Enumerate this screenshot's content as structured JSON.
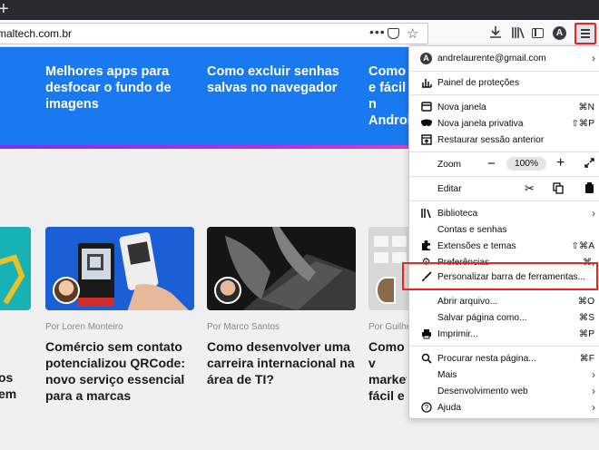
{
  "toolbar": {
    "url": "maltech.com.br",
    "dots": "•••",
    "plus": "+",
    "avatar_letter": "A"
  },
  "hero": {
    "titles": [
      "Melhores apps para desfocar o fundo de imagens",
      "Como excluir senhas salvas no navegador",
      "Como e fácil n Androi"
    ]
  },
  "cards": [
    {
      "author": "",
      "title": "os em"
    },
    {
      "author": "Por Loren Monteiro",
      "title": "Comércio sem contato potencializou QRCode: novo serviço essencial para a marcas"
    },
    {
      "author": "Por Marco Santos",
      "title": "Como desenvolver uma carreira internacional na área de TI?"
    },
    {
      "author": "Por Guilhe",
      "title": "Como v market fácil e"
    }
  ],
  "menu": {
    "account": "andrelaurente@gmail.com",
    "protections": "Painel de proteções",
    "new_window": "Nova janela",
    "new_window_sc": "⌘N",
    "new_private": "Nova janela privativa",
    "new_private_sc": "⇧⌘P",
    "restore": "Restaurar sessão anterior",
    "zoom": "Zoom",
    "zoom_value": "100%",
    "edit": "Editar",
    "library": "Biblioteca",
    "accounts": "Contas e senhas",
    "addons": "Extensões e temas",
    "addons_sc": "⇧⌘A",
    "prefs": "Preferências",
    "prefs_sc": "⌘,",
    "customize": "Personalizar barra de ferramentas...",
    "open_file": "Abrir arquivo...",
    "open_file_sc": "⌘O",
    "save_page": "Salvar página como...",
    "save_page_sc": "⌘S",
    "print": "Imprimir...",
    "print_sc": "⌘P",
    "find": "Procurar nesta página...",
    "find_sc": "⌘F",
    "more": "Mais",
    "webdev": "Desenvolvimento web",
    "help": "Ajuda"
  }
}
